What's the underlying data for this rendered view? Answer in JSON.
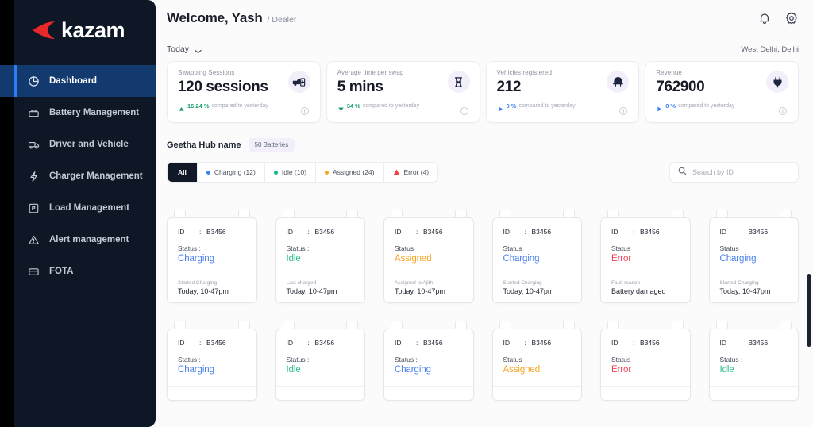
{
  "brand": {
    "name": "kazam",
    "logo_icon": "kazam-chevron-logo"
  },
  "sidebar": {
    "items": [
      {
        "label": "Dashboard",
        "icon": "pie-chart-icon",
        "active": true
      },
      {
        "label": "Battery Management",
        "icon": "battery-icon",
        "active": false
      },
      {
        "label": "Driver and Vehicle",
        "icon": "truck-icon",
        "active": false
      },
      {
        "label": "Charger Management",
        "icon": "bolt-icon",
        "active": false
      },
      {
        "label": "Load Management",
        "icon": "load-panel-icon",
        "active": false
      },
      {
        "label": "Alert management",
        "icon": "warning-triangle-icon",
        "active": false
      },
      {
        "label": "FOTA",
        "icon": "card-stack-icon",
        "active": false
      }
    ]
  },
  "header": {
    "title": "Welcome, Yash",
    "role": "/ Dealer",
    "notification_icon": "bell-icon",
    "settings_icon": "gear-icon"
  },
  "filters": {
    "period": "Today",
    "period_caret_icon": "chevron-down-icon",
    "region": "West Delhi, Delhi"
  },
  "stats": [
    {
      "label": "Swapping Sessions",
      "value": "120 sessions",
      "delta": "16.24 %",
      "comparison": "compared to yesterday",
      "trend": "up",
      "delta_color": "#18a06a",
      "icon": "vehicle-swap-icon",
      "info_icon": "info-icon"
    },
    {
      "label": "Average time per swap",
      "value": "5 mins",
      "delta": "34 %",
      "comparison": "compared to yesterday",
      "trend": "down",
      "delta_color": "#18a06a",
      "icon": "hourglass-icon",
      "info_icon": "info-icon"
    },
    {
      "label": "Vehicles registered",
      "value": "212",
      "delta": "0 %",
      "comparison": "compared to yesterday",
      "trend": "flat",
      "delta_color": "#3b82f6",
      "icon": "rickshaw-icon",
      "info_icon": "info-icon"
    },
    {
      "label": "Revenue",
      "value": "762900",
      "delta": "0 %",
      "comparison": "compared to yesterday",
      "trend": "flat",
      "delta_color": "#3b82f6",
      "icon": "plug-icon",
      "info_icon": "info-icon"
    }
  ],
  "hub": {
    "name": "Geetha Hub name",
    "battery_count_badge": "50 Batteries"
  },
  "tabs": [
    {
      "label": "All",
      "active": true,
      "marker": "none",
      "color": ""
    },
    {
      "label": "Charging (12)",
      "active": false,
      "marker": "dot",
      "color": "#3b82f6"
    },
    {
      "label": "Idle (10)",
      "active": false,
      "marker": "dot",
      "color": "#10b981"
    },
    {
      "label": "Assigned (24)",
      "active": false,
      "marker": "dot",
      "color": "#f5a623"
    },
    {
      "label": "Error (4)",
      "active": false,
      "marker": "triangle",
      "color": "#ef4444"
    }
  ],
  "search": {
    "placeholder": "Search by ID",
    "value": "",
    "icon": "search-icon"
  },
  "batteries": [
    {
      "id_key": "ID",
      "id_colon": ":",
      "id": "B3456",
      "status_label": "Status :",
      "status": "Charging",
      "status_color": "#4a7fef",
      "foot_label": "Started Charging",
      "foot_value": "Today, 10-47pm"
    },
    {
      "id_key": "ID",
      "id_colon": ":",
      "id": "B3456",
      "status_label": "Status :",
      "status": "Idle",
      "status_color": "#2bbd8c",
      "foot_label": "Last charged",
      "foot_value": "Today, 10-47pm"
    },
    {
      "id_key": "ID",
      "id_colon": ":",
      "id": "B3456",
      "status_label": "Status",
      "status": "Assigned",
      "status_color": "#f5a623",
      "foot_label": "Assigned to Ajith",
      "foot_value": "Today, 10-47pm"
    },
    {
      "id_key": "ID",
      "id_colon": ":",
      "id": "B3456",
      "status_label": "Status",
      "status": "Charging",
      "status_color": "#4a7fef",
      "foot_label": "Started Charging",
      "foot_value": "Today, 10-47pm"
    },
    {
      "id_key": "ID",
      "id_colon": ":",
      "id": "B3456",
      "status_label": "Status",
      "status": "Error",
      "status_color": "#ef4456",
      "foot_label": "Fault reason",
      "foot_value": "Battery damaged"
    },
    {
      "id_key": "ID",
      "id_colon": ":",
      "id": "B3456",
      "status_label": "Status",
      "status": "Charging",
      "status_color": "#4a7fef",
      "foot_label": "Started Charging",
      "foot_value": "Today, 10-47pm"
    },
    {
      "id_key": "ID",
      "id_colon": ":",
      "id": "B3456",
      "status_label": "Status :",
      "status": "Charging",
      "status_color": "#4a7fef",
      "foot_label": "",
      "foot_value": ""
    },
    {
      "id_key": "ID",
      "id_colon": ":",
      "id": "B3456",
      "status_label": "Status :",
      "status": "Idle",
      "status_color": "#2bbd8c",
      "foot_label": "",
      "foot_value": ""
    },
    {
      "id_key": "ID",
      "id_colon": ":",
      "id": "B3456",
      "status_label": "Status :",
      "status": "Charging",
      "status_color": "#4a7fef",
      "foot_label": "",
      "foot_value": ""
    },
    {
      "id_key": "ID",
      "id_colon": ":",
      "id": "B3456",
      "status_label": "Status",
      "status": "Assigned",
      "status_color": "#f5a623",
      "foot_label": "",
      "foot_value": ""
    },
    {
      "id_key": "ID",
      "id_colon": ":",
      "id": "B3456",
      "status_label": "Status",
      "status": "Error",
      "status_color": "#ef4456",
      "foot_label": "",
      "foot_value": ""
    },
    {
      "id_key": "ID",
      "id_colon": ":",
      "id": "B3456",
      "status_label": "Status :",
      "status": "Idle",
      "status_color": "#2bbd8c",
      "foot_label": "",
      "foot_value": ""
    }
  ],
  "colors": {
    "sidebar_bg": "#0e1726",
    "active_nav": "#133a6e",
    "accent": "#2f7cf6",
    "brand_red": "#e8282b"
  }
}
